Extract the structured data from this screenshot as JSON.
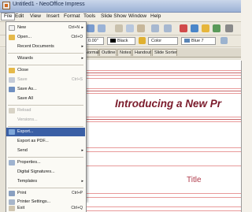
{
  "window": {
    "title": "Untitled1 - NeoOffice Impress"
  },
  "menubar": [
    "File",
    "Edit",
    "View",
    "Insert",
    "Format",
    "Tools",
    "Slide Show",
    "Window",
    "Help"
  ],
  "toolbar": {
    "line_width": "0.00\"",
    "line_color": "Black",
    "area_style": "Color",
    "area_color": "Blue 7"
  },
  "tabs": [
    "Normal",
    "Outline",
    "Notes",
    "Handout",
    "Slide Sorter"
  ],
  "file_menu": {
    "items": [
      {
        "label": "New",
        "shortcut": "Ctrl+N",
        "submenu": true,
        "enabled": true
      },
      {
        "label": "Open...",
        "shortcut": "Ctrl+O",
        "enabled": true
      },
      {
        "label": "Recent Documents",
        "submenu": true,
        "enabled": true
      },
      {
        "label": "Wizards",
        "submenu": true,
        "enabled": true
      },
      {
        "label": "Close",
        "enabled": true
      },
      {
        "label": "Save",
        "shortcut": "Ctrl+S",
        "enabled": false
      },
      {
        "label": "Save As...",
        "enabled": true
      },
      {
        "label": "Save All",
        "enabled": true
      },
      {
        "label": "Reload",
        "enabled": false
      },
      {
        "label": "Versions...",
        "enabled": false
      },
      {
        "label": "Export...",
        "enabled": true,
        "highlighted": true
      },
      {
        "label": "Export as PDF...",
        "enabled": true
      },
      {
        "label": "Send",
        "submenu": true,
        "enabled": true
      },
      {
        "label": "Properties...",
        "enabled": true
      },
      {
        "label": "Digital Signatures...",
        "enabled": true
      },
      {
        "label": "Templates",
        "submenu": true,
        "enabled": true
      },
      {
        "label": "Print",
        "shortcut": "Ctrl+P",
        "enabled": true
      },
      {
        "label": "Printer Settings...",
        "enabled": true
      },
      {
        "label": "Exit",
        "shortcut": "Ctrl+Q",
        "enabled": true
      }
    ]
  },
  "slide": {
    "title": "Introducing a New Pr",
    "subtitle": "Title"
  },
  "colors": {
    "accent": "#3a5fa5",
    "slide_title": "#7b1c2c",
    "rule": "#e89a9a"
  }
}
